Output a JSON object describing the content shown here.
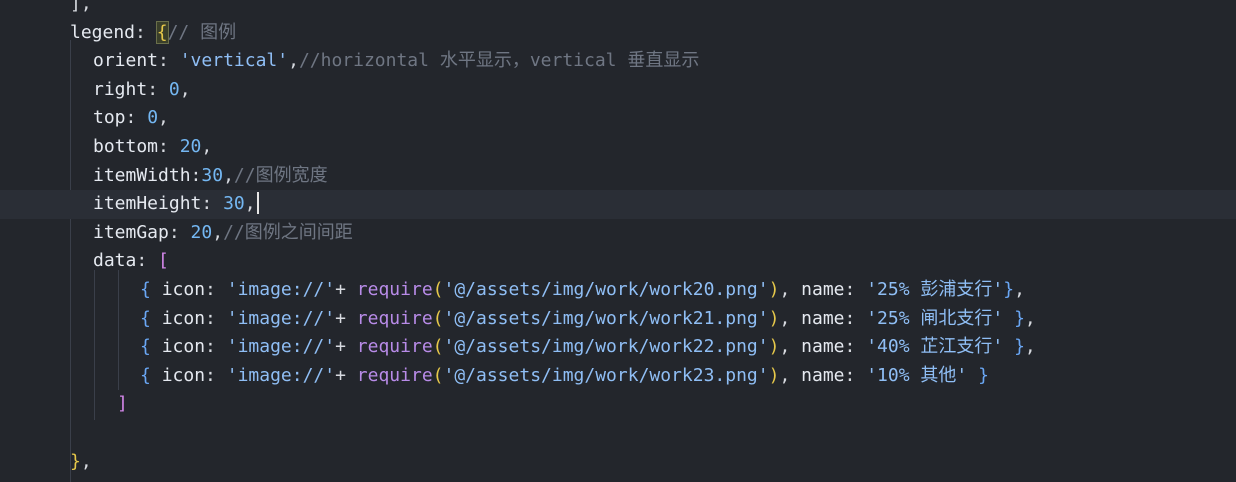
{
  "editor": {
    "lines": [
      {
        "id": "l0",
        "tokens": [
          [
            "p",
            "],"
          ]
        ]
      },
      {
        "id": "l1",
        "tokens": [
          [
            "k",
            "legend"
          ],
          [
            "p",
            ": "
          ],
          [
            "br",
            "{"
          ],
          [
            "c",
            "// 图例"
          ]
        ]
      },
      {
        "id": "l2",
        "tokens": [
          [
            "k",
            "orient"
          ],
          [
            "p",
            ": "
          ],
          [
            "s",
            "'vertical'"
          ],
          [
            "p",
            ","
          ],
          [
            "c",
            "//horizontal 水平显示，vertical 垂直显示"
          ]
        ]
      },
      {
        "id": "l3",
        "tokens": [
          [
            "k",
            "right"
          ],
          [
            "p",
            ": "
          ],
          [
            "n",
            "0"
          ],
          [
            "p",
            ","
          ]
        ]
      },
      {
        "id": "l4",
        "tokens": [
          [
            "k",
            "top"
          ],
          [
            "p",
            ": "
          ],
          [
            "n",
            "0"
          ],
          [
            "p",
            ","
          ]
        ]
      },
      {
        "id": "l5",
        "tokens": [
          [
            "k",
            "bottom"
          ],
          [
            "p",
            ": "
          ],
          [
            "n",
            "20"
          ],
          [
            "p",
            ","
          ]
        ]
      },
      {
        "id": "l6",
        "tokens": [
          [
            "k",
            "itemWidth"
          ],
          [
            "p",
            ":"
          ],
          [
            "n",
            "30"
          ],
          [
            "p",
            ","
          ],
          [
            "c",
            "//图例宽度"
          ]
        ]
      },
      {
        "id": "l7",
        "tokens": [
          [
            "k",
            "itemHeight"
          ],
          [
            "p",
            ": "
          ],
          [
            "n",
            "30"
          ],
          [
            "p",
            ","
          ]
        ]
      },
      {
        "id": "l8",
        "tokens": [
          [
            "k",
            "itemGap"
          ],
          [
            "p",
            ": "
          ],
          [
            "n",
            "20"
          ],
          [
            "p",
            ","
          ],
          [
            "c",
            "//图例之间间距"
          ]
        ]
      },
      {
        "id": "l9",
        "tokens": [
          [
            "k",
            "data"
          ],
          [
            "p",
            ": "
          ],
          [
            "br2",
            "["
          ]
        ]
      },
      {
        "id": "l10",
        "tokens": [
          [
            "brb",
            "{"
          ],
          [
            "p",
            " "
          ],
          [
            "k",
            "icon"
          ],
          [
            "p",
            ": "
          ],
          [
            "s",
            "'image://'"
          ],
          [
            "p",
            "+ "
          ],
          [
            "f",
            "require"
          ],
          [
            "br",
            "("
          ],
          [
            "s",
            "'@/assets/img/work/work20.png'"
          ],
          [
            "br",
            ")"
          ],
          [
            "p",
            ", "
          ],
          [
            "k",
            "name"
          ],
          [
            "p",
            ": "
          ],
          [
            "s",
            "'25% 彭浦支行'"
          ],
          [
            "brb",
            "}"
          ],
          [
            "p",
            ","
          ]
        ]
      },
      {
        "id": "l11",
        "tokens": [
          [
            "brb",
            "{"
          ],
          [
            "p",
            " "
          ],
          [
            "k",
            "icon"
          ],
          [
            "p",
            ": "
          ],
          [
            "s",
            "'image://'"
          ],
          [
            "p",
            "+ "
          ],
          [
            "f",
            "require"
          ],
          [
            "br",
            "("
          ],
          [
            "s",
            "'@/assets/img/work/work21.png'"
          ],
          [
            "br",
            ")"
          ],
          [
            "p",
            ", "
          ],
          [
            "k",
            "name"
          ],
          [
            "p",
            ": "
          ],
          [
            "s",
            "'25% 闸北支行'"
          ],
          [
            "p",
            " "
          ],
          [
            "brb",
            "}"
          ],
          [
            "p",
            ","
          ]
        ]
      },
      {
        "id": "l12",
        "tokens": [
          [
            "brb",
            "{"
          ],
          [
            "p",
            " "
          ],
          [
            "k",
            "icon"
          ],
          [
            "p",
            ": "
          ],
          [
            "s",
            "'image://'"
          ],
          [
            "p",
            "+ "
          ],
          [
            "f",
            "require"
          ],
          [
            "br",
            "("
          ],
          [
            "s",
            "'@/assets/img/work/work22.png'"
          ],
          [
            "br",
            ")"
          ],
          [
            "p",
            ", "
          ],
          [
            "k",
            "name"
          ],
          [
            "p",
            ": "
          ],
          [
            "s",
            "'40% 芷江支行'"
          ],
          [
            "p",
            " "
          ],
          [
            "brb",
            "}"
          ],
          [
            "p",
            ","
          ]
        ]
      },
      {
        "id": "l13",
        "tokens": [
          [
            "brb",
            "{"
          ],
          [
            "p",
            " "
          ],
          [
            "k",
            "icon"
          ],
          [
            "p",
            ": "
          ],
          [
            "s",
            "'image://'"
          ],
          [
            "p",
            "+ "
          ],
          [
            "f",
            "require"
          ],
          [
            "br",
            "("
          ],
          [
            "s",
            "'@/assets/img/work/work23.png'"
          ],
          [
            "br",
            ")"
          ],
          [
            "p",
            ", "
          ],
          [
            "k",
            "name"
          ],
          [
            "p",
            ": "
          ],
          [
            "s",
            "'10% 其他'"
          ],
          [
            "p",
            " "
          ],
          [
            "brb",
            "}"
          ]
        ]
      },
      {
        "id": "l14",
        "tokens": [
          [
            "br2",
            "]"
          ]
        ]
      },
      {
        "id": "l15",
        "tokens": []
      },
      {
        "id": "l16",
        "tokens": [
          [
            "br",
            "}"
          ],
          [
            "p",
            ","
          ]
        ]
      }
    ]
  }
}
